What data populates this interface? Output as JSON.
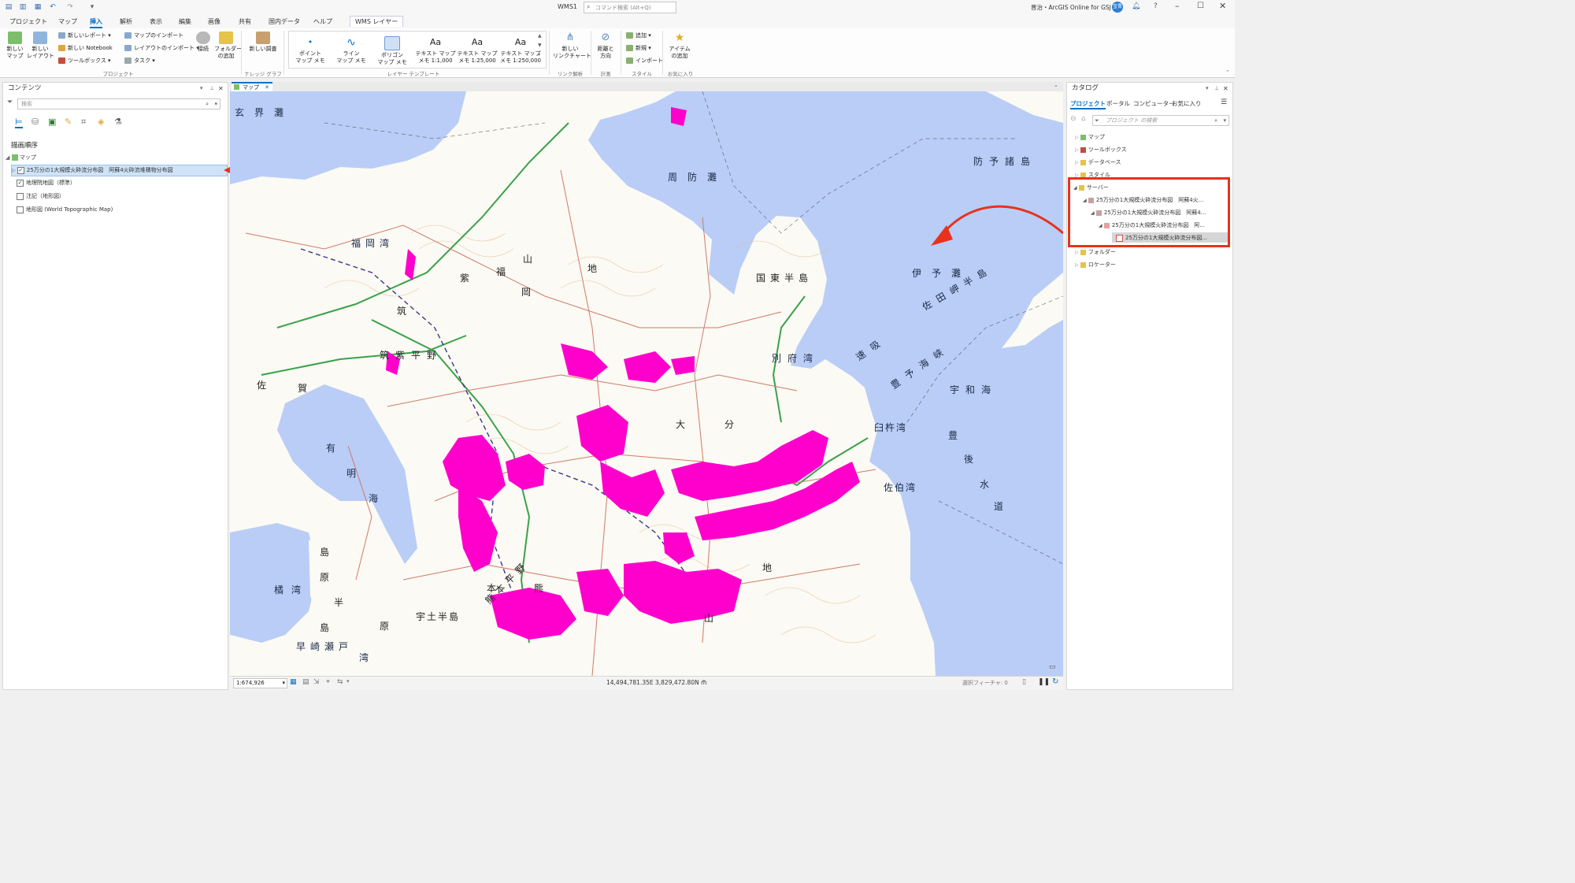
{
  "window": {
    "title": "WMS1",
    "search_placeholder": "コマンド検索 (Alt+Q)",
    "user": "晋治・ArcGIS Online for GSJ",
    "avatar": "宝晋"
  },
  "ribbon_tabs": [
    "プロジェクト",
    "マップ",
    "挿入",
    "解析",
    "表示",
    "編集",
    "画像",
    "共有",
    "国内データ",
    "ヘルプ"
  ],
  "active_tab": "挿入",
  "contextual_tab": "WMS レイヤー",
  "ribbon": {
    "new_map": "新しい\nマップ",
    "new_layout": "新しい\nレイアウト",
    "new_report": "新しいレポート",
    "new_notebook": "新しい Notebook",
    "toolbox": "ツールボックス",
    "import_map": "マップのインポート",
    "import_layout": "レイアウトのインポート",
    "task": "タスク",
    "connect": "接続",
    "add_folder": "フォルダー\nの追加",
    "group_project": "プロジェクト",
    "new_survey": "新しい調査",
    "group_knowledge": "ナレッジ グラフ",
    "layer_templates": [
      "ポイント\nマップ メモ",
      "ライン\nマップ メモ",
      "ポリゴン\nマップ メモ",
      "テキスト マップ\nメモ 1:1,000",
      "テキスト マップ\nメモ 1:25,000",
      "テキスト マップ\nメモ 1:250,000"
    ],
    "group_layer_template": "レイヤー テンプレート",
    "new_link_chart": "新しい\nリンクチャート",
    "group_link": "リンク解析",
    "distance_direction": "距離と\n方向",
    "group_measure": "計測",
    "style_add": "追加",
    "style_new": "新規",
    "style_import": "インポート",
    "group_style": "スタイル",
    "add_item": "アイテム\nの追加",
    "group_favorites": "お気に入り"
  },
  "contents": {
    "title": "コンテンツ",
    "search_placeholder": "検索",
    "drawing_order": "描画順序",
    "map_node": "マップ",
    "layers": [
      {
        "label": "25万分の1大規模火砕流分布図　阿蘇4火砕流堆積物分布図",
        "checked": true,
        "selected": true
      },
      {
        "label": "地理院地図（標準）",
        "checked": true,
        "selected": false
      },
      {
        "label": "注記（地形図）",
        "checked": false,
        "selected": false
      },
      {
        "label": "地形図 (World Topographic Map)",
        "checked": false,
        "selected": false
      }
    ]
  },
  "map": {
    "tab_label": "マップ",
    "scale": "1:674,926",
    "coordinates": "14,494,781.35E 3,829,472.80N m",
    "selected_features": "選択フィーチャ: 0",
    "place_labels": [
      "玄界灘",
      "周防灘",
      "防予諸島",
      "伊予灘",
      "国東半島",
      "福岡湾",
      "佐田岬半島",
      "福",
      "山",
      "岡",
      "地",
      "紫",
      "筑",
      "筑紫平野",
      "佐",
      "賀",
      "別府湾",
      "速吸",
      "豊予海峡",
      "宇和海",
      "臼杵湾",
      "有",
      "明",
      "海",
      "大",
      "分",
      "豊",
      "後",
      "水",
      "道",
      "佐伯湾",
      "地",
      "熊本平野",
      "熊",
      "本",
      "宇土半島",
      "島",
      "原",
      "半",
      "橘湾",
      "早崎瀬戸",
      "山",
      "原",
      "湾",
      "島"
    ]
  },
  "catalog": {
    "title": "カタログ",
    "tabs": [
      "プロジェクト",
      "ポータル",
      "コンピューター",
      "お気に入り"
    ],
    "search_placeholder": "プロジェクト の検索",
    "items": [
      {
        "label": "マップ",
        "level": 0
      },
      {
        "label": "ツールボックス",
        "level": 0
      },
      {
        "label": "データベース",
        "level": 0
      },
      {
        "label": "スタイル",
        "level": 0
      },
      {
        "label": "サーバー",
        "level": 0
      },
      {
        "label": "25万分の1大規模火砕流分布図　阿蘇4火...",
        "level": 1
      },
      {
        "label": "25万分の1大規模火砕流分布図　阿蘇4...",
        "level": 2
      },
      {
        "label": "25万分の1大規模火砕流分布図　阿...",
        "level": 3
      },
      {
        "label": "25万分の1大規模火砕流分布図...",
        "level": 4
      },
      {
        "label": "フォルダー",
        "level": 0
      },
      {
        "label": "ロケーター",
        "level": 0
      }
    ]
  },
  "colors": {
    "accent": "#0b6fc2",
    "annotation": "#e8321e",
    "pyroclastic": "#ff00cc",
    "sea": "#b9cdf6"
  }
}
